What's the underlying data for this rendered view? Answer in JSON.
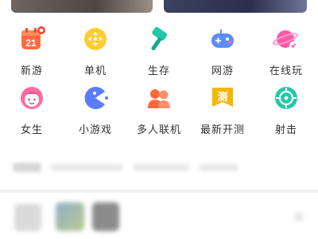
{
  "categories": [
    {
      "label": "新游",
      "icon": "calendar-badge-icon",
      "calendar_day": "21",
      "color": "#ff6a3d"
    },
    {
      "label": "单机",
      "icon": "controller-dpad-icon",
      "color": "#ffcc33"
    },
    {
      "label": "生存",
      "icon": "hammer-icon",
      "color": "#22c8a8"
    },
    {
      "label": "网游",
      "icon": "gamepad-icon",
      "color": "#5b8cff"
    },
    {
      "label": "在线玩",
      "icon": "planet-icon",
      "color": "#ff5aa8"
    },
    {
      "label": "女生",
      "icon": "girl-face-icon",
      "color": "#ff6aa0"
    },
    {
      "label": "小游戏",
      "icon": "pacman-icon",
      "color": "#5b7cff"
    },
    {
      "label": "多人联机",
      "icon": "two-people-icon",
      "color": "#ff6a3d"
    },
    {
      "label": "最新开测",
      "icon": "test-flag-icon",
      "badge_text": "测",
      "color": "#f2b705"
    },
    {
      "label": "射击",
      "icon": "crosshair-icon",
      "color": "#22c8a8"
    }
  ]
}
